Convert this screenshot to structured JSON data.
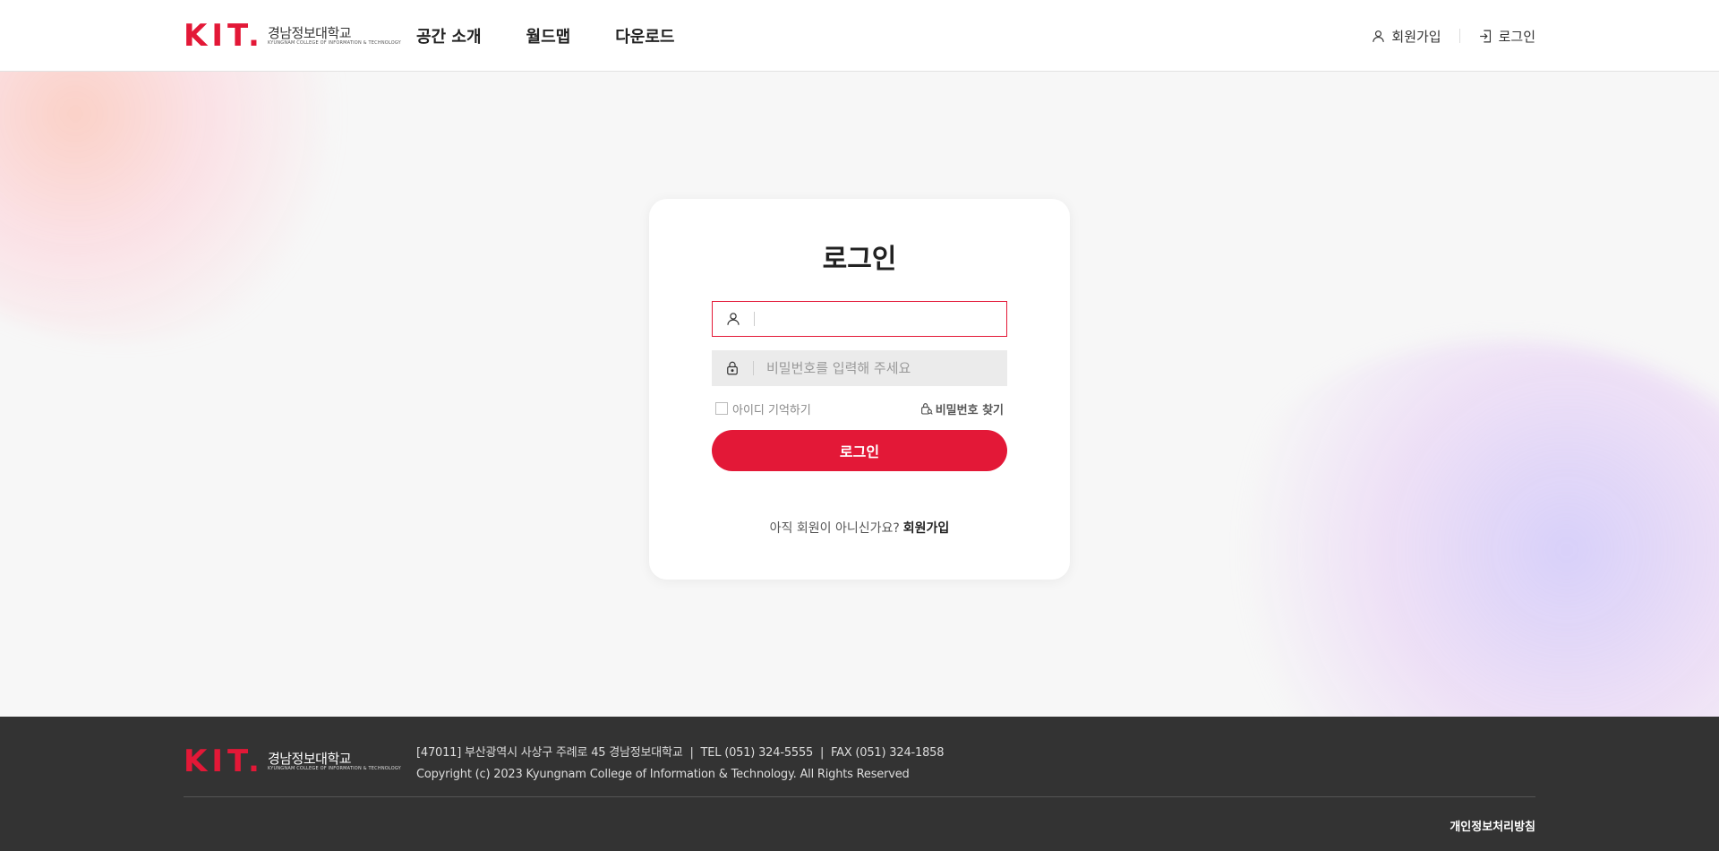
{
  "brand": {
    "logo_mark": "KIT.",
    "name_ko": "경남정보대학교",
    "name_en": "KYUNGNAM COLLEGE OF INFORMATION & TECHNOLOGY",
    "accent_color": "#e31837"
  },
  "nav": {
    "items": [
      {
        "label": "공간 소개"
      },
      {
        "label": "월드맵"
      },
      {
        "label": "다운로드"
      }
    ]
  },
  "util": {
    "signup_label": "회원가입",
    "signup_icon": "user-icon",
    "login_label": "로그인",
    "login_icon": "login-icon"
  },
  "login": {
    "title": "로그인",
    "id_field": {
      "value": "",
      "placeholder": "",
      "icon": "user-icon"
    },
    "pw_field": {
      "value": "",
      "placeholder": "비밀번호를 입력해 주세요",
      "icon": "lock-icon"
    },
    "remember_label": "아이디 기억하기",
    "find_pw_label": "비밀번호 찾기",
    "submit_label": "로그인",
    "join_prompt": "아직 회원이 아니신가요?",
    "join_link": "회원가입"
  },
  "footer": {
    "address_line": "[47011] 부산광역시 사상구 주례로 45 경남정보대학교  |  TEL (051) 324-5555  |  FAX (051) 324-1858",
    "copyright": "Copyright (c) 2023 Kyungnam College of Information & Technology. All Rights Reserved",
    "privacy_label": "개인정보처리방침"
  }
}
